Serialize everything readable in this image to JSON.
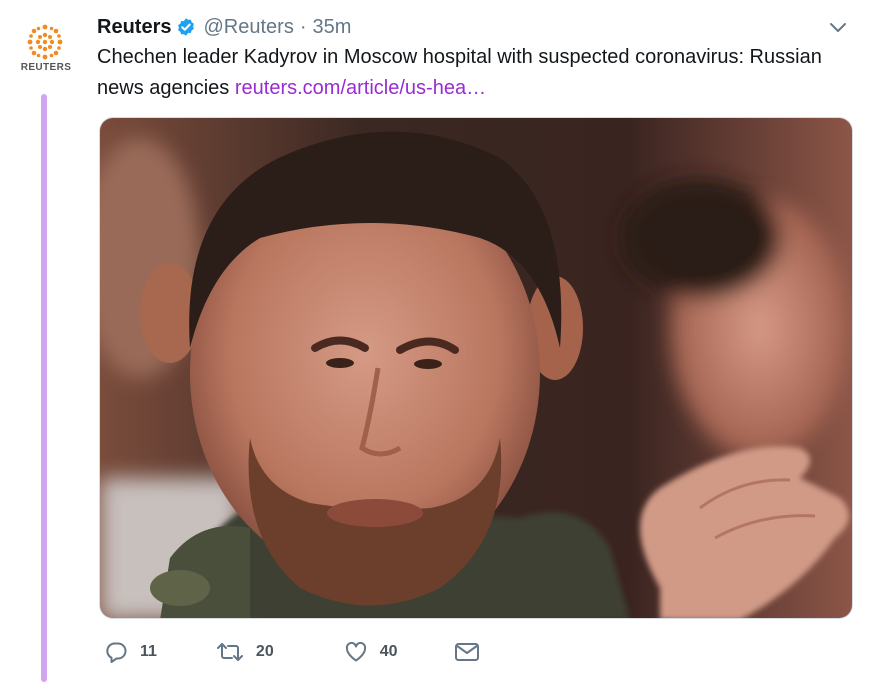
{
  "account": {
    "display_name": "Reuters",
    "handle": "@Reuters",
    "separator": "·",
    "time": "35m",
    "avatar_wordmark": "REUTERS",
    "verified_icon": "verified-badge-icon"
  },
  "tweet": {
    "text": "Chechen leader Kadyrov in Moscow hospital with suspected coronavirus: Russian news agencies ",
    "link_text": "reuters.com/article/us-hea…"
  },
  "media": {
    "description_icon": "photo-image"
  },
  "actions": {
    "reply_count": "11",
    "retweet_count": "20",
    "like_count": "40"
  },
  "colors": {
    "link": "#9a2bd3",
    "thread_line": "#d1a5f0",
    "verified": "#1da1f2",
    "muted": "#657786",
    "reuters_orange": "#f28b20"
  }
}
